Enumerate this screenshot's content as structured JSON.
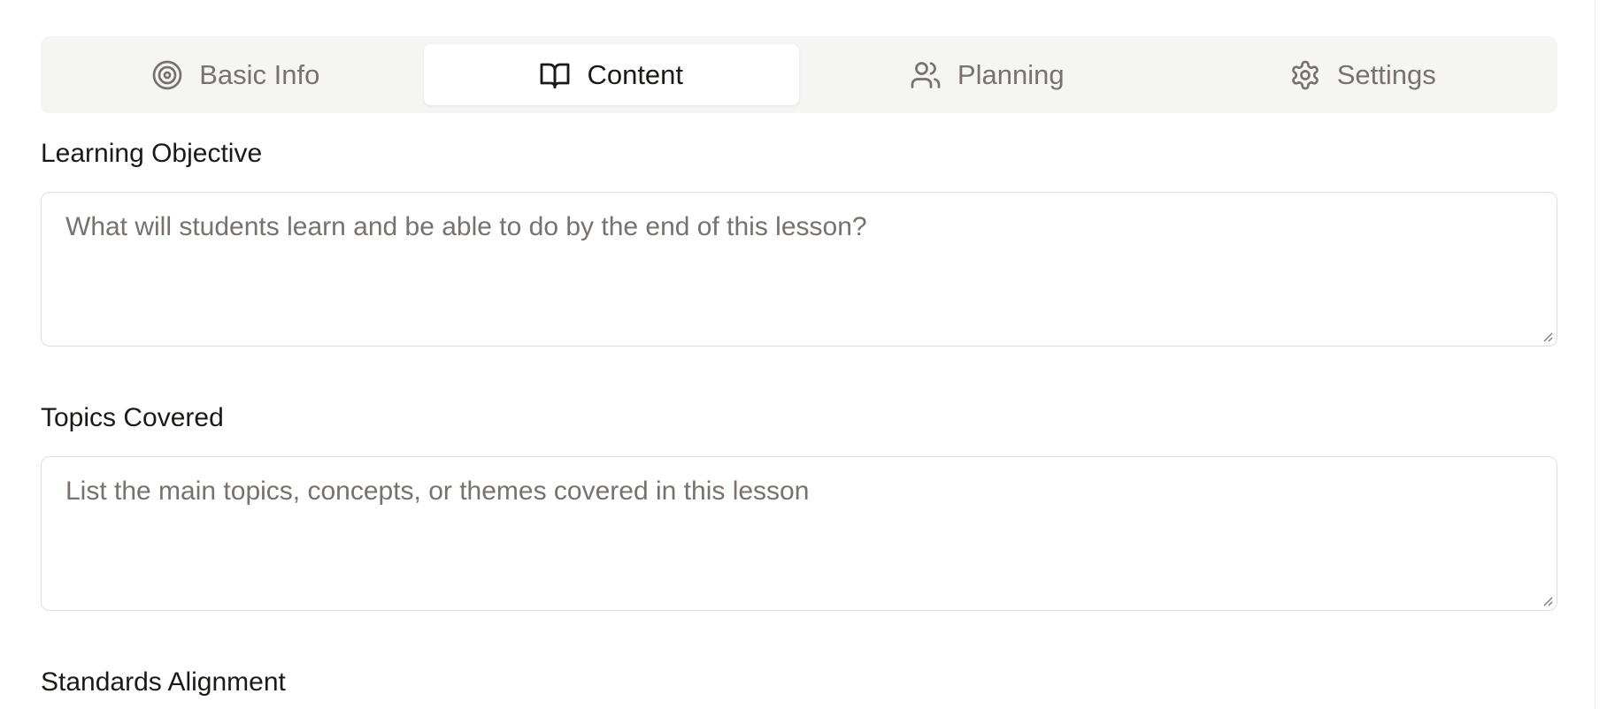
{
  "tabs": [
    {
      "label": "Basic Info",
      "icon": "target-icon",
      "active": false
    },
    {
      "label": "Content",
      "icon": "book-open-icon",
      "active": true
    },
    {
      "label": "Planning",
      "icon": "users-icon",
      "active": false
    },
    {
      "label": "Settings",
      "icon": "gear-icon",
      "active": false
    }
  ],
  "fields": {
    "learning_objective": {
      "label": "Learning Objective",
      "placeholder": "What will students learn and be able to do by the end of this lesson?",
      "value": ""
    },
    "topics_covered": {
      "label": "Topics Covered",
      "placeholder": "List the main topics, concepts, or themes covered in this lesson",
      "value": ""
    },
    "standards_alignment": {
      "label": "Standards Alignment"
    }
  },
  "colors": {
    "tab_bar_bg": "#f5f5f4",
    "active_tab_bg": "#ffffff",
    "inactive_text": "#78716c",
    "active_text": "#1c1917",
    "border": "#e0dedc"
  }
}
